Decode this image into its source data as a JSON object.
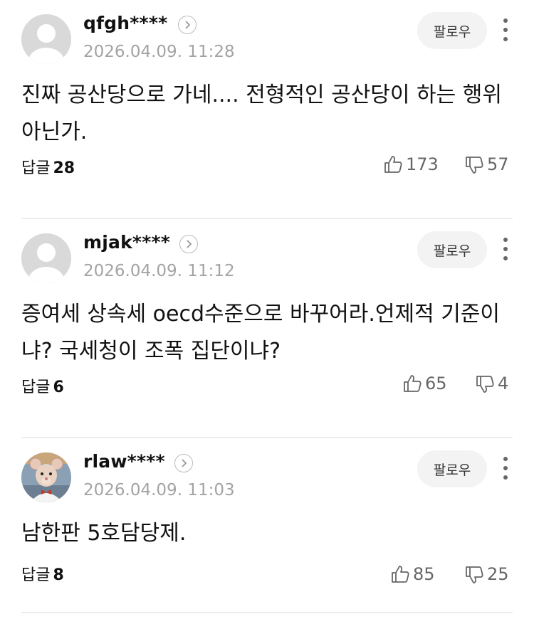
{
  "comments": [
    {
      "username": "qfgh****",
      "date": "2026.04.09. 11:28",
      "text": "진짜 공산당으로 가네.... 전형적인 공산당이 하는 행위아닌가.",
      "follow_label": "팔로우",
      "reply_label": "답글",
      "reply_count": "28",
      "likes": "173",
      "dislikes": "57",
      "avatar": "default-avatar"
    },
    {
      "username": "mjak****",
      "date": "2026.04.09. 11:12",
      "text": "증여세 상속세 oecd수준으로 바꾸어라.언제적 기준이냐? 국세청이 조폭 집단이냐?",
      "follow_label": "팔로우",
      "reply_label": "답글",
      "reply_count": "6",
      "likes": "65",
      "dislikes": "4",
      "avatar": "default-avatar"
    },
    {
      "username": "rlaw****",
      "date": "2026.04.09. 11:03",
      "text": "남한판 5호담당제.",
      "follow_label": "팔로우",
      "reply_label": "답글",
      "reply_count": "8",
      "likes": "85",
      "dislikes": "25",
      "avatar": "mouse-character-avatar"
    }
  ],
  "colors": {
    "text": "#111111",
    "meta": "#a3a3a3",
    "count": "#666666",
    "follow_bg": "#f3f3f3",
    "divider": "#eeeeee"
  },
  "icons": [
    "chevron-right-icon",
    "more-vertical-icon",
    "thumbs-up-icon",
    "thumbs-down-icon"
  ]
}
